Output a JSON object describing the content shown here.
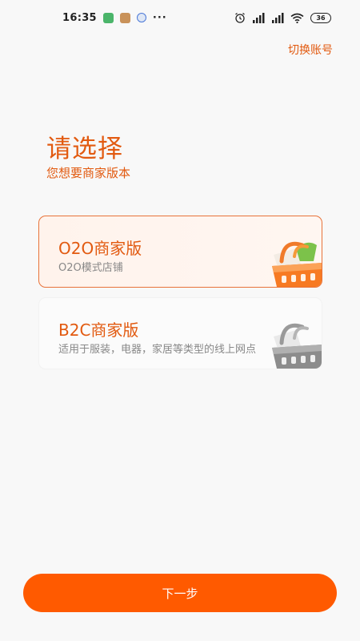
{
  "status_bar": {
    "time": "16:35",
    "more": "···",
    "battery": "36"
  },
  "header": {
    "switch_account": "切换账号"
  },
  "intro": {
    "title": "请选择",
    "subtitle": "您想要商家版本"
  },
  "options": [
    {
      "title": "O2O商家版",
      "desc": "O2O模式店铺",
      "selected": true,
      "icon": "orange-basket-icon"
    },
    {
      "title": "B2C商家版",
      "desc": "适用于服装，电器，家居等类型的线上网点",
      "selected": false,
      "icon": "gray-basket-icon"
    }
  ],
  "footer": {
    "next_label": "下一步"
  },
  "colors": {
    "accent": "#e25a10",
    "button": "#ff5a00",
    "selected_border": "#e8733a"
  }
}
